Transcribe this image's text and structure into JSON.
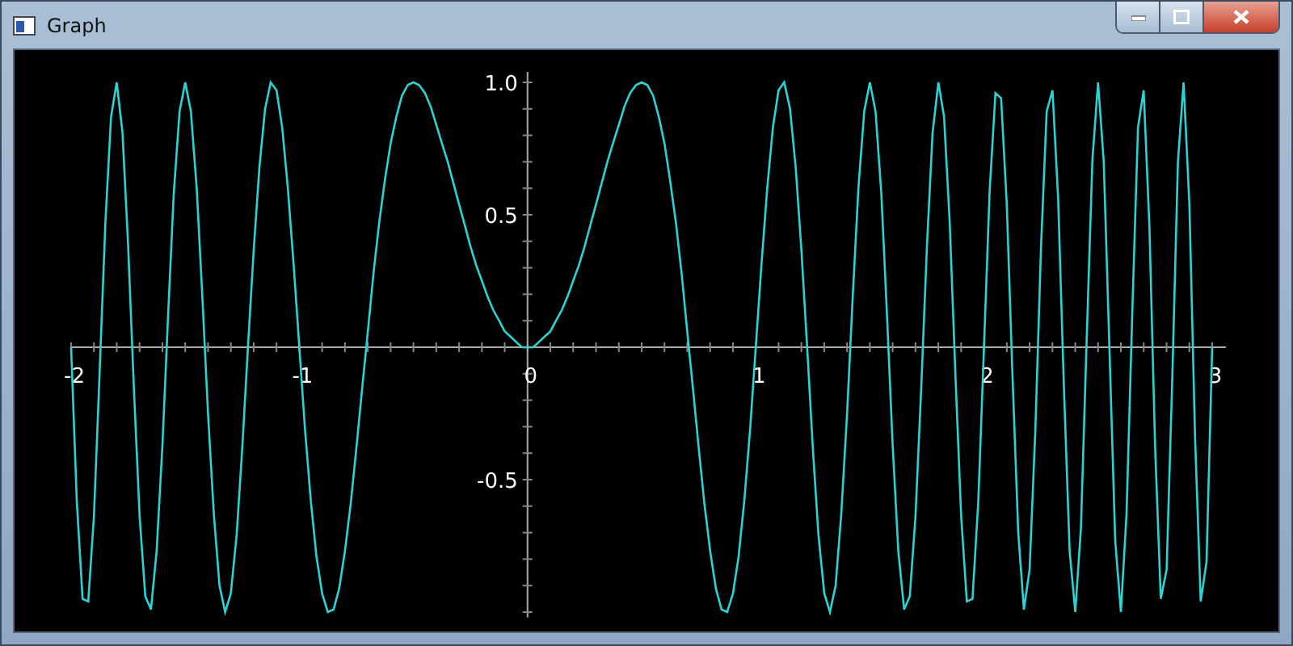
{
  "window": {
    "title": "Graph"
  },
  "chart_data": {
    "type": "line",
    "xlim": [
      -2,
      3.06
    ],
    "ylim": [
      -1.02,
      1.04
    ],
    "xticks": [
      -2,
      -1,
      0,
      1,
      2,
      3
    ],
    "yticks": [
      {
        "value": 1,
        "label": "1.0"
      },
      0.5,
      -0.5
    ],
    "x": [
      -2,
      -1.975,
      -1.95,
      -1.925,
      -1.9,
      -1.875,
      -1.85,
      -1.825,
      -1.8,
      -1.775,
      -1.75,
      -1.725,
      -1.7,
      -1.675,
      -1.65,
      -1.625,
      -1.6,
      -1.575,
      -1.55,
      -1.525,
      -1.5,
      -1.475,
      -1.45,
      -1.425,
      -1.4,
      -1.375,
      -1.35,
      -1.325,
      -1.3,
      -1.275,
      -1.25,
      -1.225,
      -1.2,
      -1.175,
      -1.15,
      -1.125,
      -1.1,
      -1.075,
      -1.05,
      -1.025,
      -1,
      -0.975,
      -0.95,
      -0.925,
      -0.9,
      -0.875,
      -0.85,
      -0.825,
      -0.8,
      -0.775,
      -0.75,
      -0.725,
      -0.7,
      -0.675,
      -0.65,
      -0.625,
      -0.6,
      -0.575,
      -0.55,
      -0.525,
      -0.5,
      -0.475,
      -0.45,
      -0.425,
      -0.4,
      -0.375,
      -0.35,
      -0.325,
      -0.3,
      -0.275,
      -0.25,
      -0.225,
      -0.2,
      -0.175,
      -0.15,
      -0.125,
      -0.1,
      -0.075,
      -0.05,
      -0.025,
      0,
      0.025,
      0.05,
      0.075,
      0.1,
      0.125,
      0.15,
      0.175,
      0.2,
      0.225,
      0.25,
      0.275,
      0.3,
      0.325,
      0.35,
      0.375,
      0.4,
      0.425,
      0.45,
      0.475,
      0.5,
      0.525,
      0.55,
      0.575,
      0.6,
      0.625,
      0.65,
      0.675,
      0.7,
      0.725,
      0.75,
      0.775,
      0.8,
      0.825,
      0.85,
      0.875,
      0.9,
      0.925,
      0.95,
      0.975,
      1,
      1.025,
      1.05,
      1.075,
      1.1,
      1.125,
      1.15,
      1.175,
      1.2,
      1.225,
      1.25,
      1.275,
      1.3,
      1.325,
      1.35,
      1.375,
      1.4,
      1.425,
      1.45,
      1.475,
      1.5,
      1.525,
      1.55,
      1.575,
      1.6,
      1.625,
      1.65,
      1.675,
      1.7,
      1.725,
      1.75,
      1.775,
      1.8,
      1.825,
      1.85,
      1.875,
      1.9,
      1.925,
      1.95,
      1.975,
      2,
      2.025,
      2.05,
      2.075,
      2.1,
      2.125,
      2.15,
      2.175,
      2.2,
      2.225,
      2.25,
      2.275,
      2.3,
      2.325,
      2.35,
      2.375,
      2.4,
      2.425,
      2.45,
      2.475,
      2.5,
      2.525,
      2.55,
      2.575,
      2.6,
      2.625,
      2.65,
      2.675,
      2.7,
      2.725,
      2.75,
      2.775,
      2.8,
      2.825,
      2.85,
      2.875,
      2.9,
      2.925,
      2.95,
      2.975,
      3
    ],
    "series": [
      {
        "color": "#2ad4d4",
        "values": [
          0,
          -0.58,
          -0.95,
          -0.96,
          -0.64,
          -0.1,
          0.47,
          0.87,
          1,
          0.81,
          0.38,
          -0.15,
          -0.64,
          -0.94,
          -0.99,
          -0.77,
          -0.37,
          0.12,
          0.58,
          0.89,
          1,
          0.89,
          0.6,
          0.19,
          -0.25,
          -0.63,
          -0.9,
          -1,
          -0.93,
          -0.71,
          -0.38,
          0,
          0.37,
          0.68,
          0.9,
          1,
          0.97,
          0.83,
          0.6,
          0.31,
          0,
          -0.31,
          -0.58,
          -0.79,
          -0.93,
          -1,
          -0.99,
          -0.91,
          -0.77,
          -0.59,
          -0.38,
          -0.16,
          0.06,
          0.28,
          0.47,
          0.63,
          0.77,
          0.87,
          0.95,
          0.99,
          1,
          0.99,
          0.96,
          0.91,
          0.84,
          0.77,
          0.7,
          0.62,
          0.54,
          0.46,
          0.38,
          0.31,
          0.25,
          0.19,
          0.14,
          0.1,
          0.06,
          0.04,
          0.02,
          0,
          0,
          0,
          0.02,
          0.04,
          0.06,
          0.1,
          0.14,
          0.19,
          0.25,
          0.31,
          0.38,
          0.46,
          0.54,
          0.62,
          0.7,
          0.77,
          0.84,
          0.91,
          0.96,
          0.99,
          1,
          0.99,
          0.95,
          0.87,
          0.77,
          0.63,
          0.47,
          0.28,
          0.06,
          -0.16,
          -0.38,
          -0.59,
          -0.77,
          -0.91,
          -0.99,
          -1,
          -0.93,
          -0.79,
          -0.58,
          -0.31,
          0,
          0.31,
          0.6,
          0.83,
          0.97,
          1,
          0.9,
          0.68,
          0.37,
          0,
          -0.38,
          -0.71,
          -0.93,
          -1,
          -0.9,
          -0.63,
          -0.25,
          0.19,
          0.6,
          0.89,
          1,
          0.89,
          0.58,
          0.12,
          -0.37,
          -0.77,
          -0.99,
          -0.94,
          -0.64,
          -0.15,
          0.38,
          0.81,
          1,
          0.87,
          0.47,
          -0.1,
          -0.64,
          -0.96,
          -0.95,
          -0.58,
          0,
          0.59,
          0.96,
          0.94,
          0.54,
          -0.1,
          -0.7,
          -0.99,
          -0.84,
          -0.31,
          0.38,
          0.89,
          0.97,
          0.56,
          -0.14,
          -0.77,
          -1,
          -0.68,
          0.02,
          0.71,
          1,
          0.7,
          -0.02,
          -0.73,
          -1,
          -0.63,
          0.14,
          0.83,
          0.97,
          0.45,
          -0.38,
          -0.95,
          -0.84,
          -0.12,
          0.7,
          1,
          0.54,
          -0.34,
          -0.96,
          -0.81,
          0
        ]
      }
    ]
  }
}
